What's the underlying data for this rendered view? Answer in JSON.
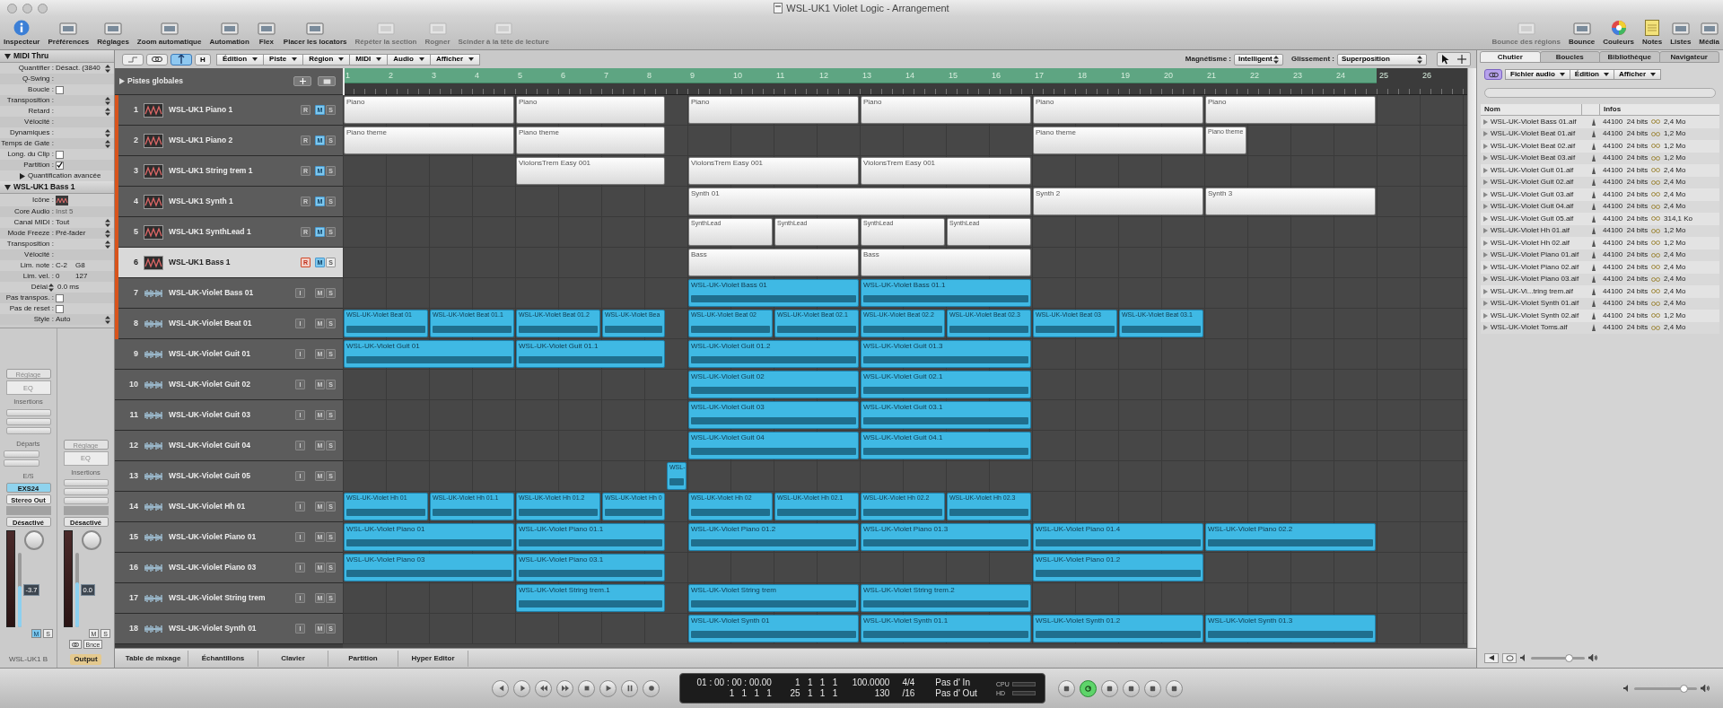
{
  "window": {
    "title": "WSL-UK1 Violet Logic - Arrangement"
  },
  "toolbar": {
    "left": [
      {
        "label": "Inspecteur",
        "active": true,
        "disabled": false
      },
      {
        "label": "Préférences",
        "active": false,
        "disabled": false
      },
      {
        "label": "Réglages",
        "active": false,
        "disabled": false
      },
      {
        "label": "Zoom automatique",
        "active": false,
        "disabled": false
      },
      {
        "label": "Automation",
        "active": false,
        "disabled": false
      },
      {
        "label": "Flex",
        "active": false,
        "disabled": false
      },
      {
        "label": "Placer les locators",
        "active": false,
        "disabled": false
      },
      {
        "label": "Répéter la section",
        "active": false,
        "disabled": true
      },
      {
        "label": "Rogner",
        "active": false,
        "disabled": true
      },
      {
        "label": "Scinder à la tête de lecture",
        "active": false,
        "disabled": true
      }
    ],
    "right": [
      {
        "label": "Bounce des régions",
        "active": false,
        "disabled": true
      },
      {
        "label": "Bounce",
        "active": false,
        "disabled": false
      },
      {
        "label": "Couleurs",
        "active": false,
        "disabled": false
      },
      {
        "label": "Notes",
        "active": false,
        "disabled": false
      },
      {
        "label": "Listes",
        "active": false,
        "disabled": false
      },
      {
        "label": "Média",
        "active": false,
        "disabled": false
      }
    ]
  },
  "inspector": {
    "sections": [
      {
        "title": "MIDI Thru",
        "rows": [
          {
            "label": "Quantifier :",
            "kind": "select",
            "value": "Désact. (3840"
          },
          {
            "label": "Q-Swing :",
            "kind": "label"
          },
          {
            "label": "Boucle :",
            "kind": "checkbox",
            "checked": false
          },
          {
            "label": "Transposition :",
            "kind": "select"
          },
          {
            "label": "Retard :",
            "kind": "select"
          },
          {
            "label": "Vélocité :",
            "kind": "label"
          },
          {
            "label": "Dynamiques :",
            "kind": "select"
          },
          {
            "label": "Temps de Gate :",
            "kind": "select"
          },
          {
            "label": "Long. du Clip :",
            "kind": "checkbox",
            "checked": false
          },
          {
            "label": "Partition :",
            "kind": "checkbox",
            "checked": true
          },
          {
            "label": "Quantification avancée",
            "kind": "disclosure"
          }
        ]
      },
      {
        "title": "WSL-UK1 Bass 1",
        "rows": [
          {
            "label": "Icône :",
            "kind": "icon"
          },
          {
            "label": "Core Audio :",
            "kind": "dim",
            "value": "Inst 5"
          },
          {
            "label": "Canal MIDI :",
            "kind": "select",
            "value": "Tout"
          },
          {
            "label": "Mode Freeze :",
            "kind": "select",
            "value": "Pré-fader"
          },
          {
            "label": "Transposition :",
            "kind": "select"
          },
          {
            "label": "Vélocité :",
            "kind": "label"
          },
          {
            "label": "Lim. note :",
            "kind": "pair",
            "values": [
              "C-2",
              "G8"
            ]
          },
          {
            "label": "Lim. vel. :",
            "kind": "pair",
            "values": [
              "0",
              "127"
            ]
          },
          {
            "label": "Délai",
            "kind": "stepper",
            "value": "0.0 ms"
          },
          {
            "label": "Pas transpos. :",
            "kind": "checkbox",
            "checked": false
          },
          {
            "label": "Pas de reset :",
            "kind": "checkbox",
            "checked": false
          },
          {
            "label": "Style :",
            "kind": "select",
            "value": "Auto"
          }
        ]
      }
    ],
    "strips": [
      {
        "setting": "Réglage",
        "eq": "EQ",
        "inserts": "Insertions",
        "sends": "Départs",
        "io": "E/S",
        "input": "EXS24",
        "output": "Stereo Out",
        "automation": "Désactivé",
        "volume": "-3.7",
        "level": 0.55,
        "mute": "M",
        "muted": true,
        "solo": "S",
        "name": "WSL-UK1 B",
        "highlight": false
      },
      {
        "setting": "Réglage",
        "eq": "EQ",
        "inserts": "Insertions",
        "automation": "Désactivé",
        "volume": "0.0",
        "level": 0.6,
        "mute": "M",
        "muted": false,
        "solo": "S",
        "bounce": "Bnce",
        "name": "Output",
        "highlight": true
      }
    ]
  },
  "arrange": {
    "toggles": [
      {
        "on": false
      },
      {
        "on": false
      },
      {
        "on": true
      }
    ],
    "h_button": "H",
    "menus": [
      "Édition",
      "Piste",
      "Région",
      "MIDI",
      "Audio",
      "Afficher"
    ],
    "snap": {
      "label": "Magnétisme :",
      "value": "Intelligent"
    },
    "drag": {
      "label": "Glissement :",
      "value": "Superposition"
    },
    "global_tracks": "Pistes globales",
    "ruler": {
      "bars": [
        "1",
        "2",
        "3",
        "4",
        "5",
        "6",
        "7",
        "8",
        "9",
        "10",
        "11",
        "12",
        "13",
        "14",
        "15",
        "16",
        "17",
        "18",
        "19",
        "20",
        "21",
        "22",
        "23",
        "24",
        "25",
        "26"
      ]
    },
    "tracks": [
      {
        "number": "1",
        "kind": "software",
        "name": "WSL-UK1 Piano 1",
        "selected": false,
        "marker": true,
        "buttons": [
          {
            "label": "R",
            "on": false
          },
          {
            "label": "M",
            "on": true
          },
          {
            "label": "S",
            "on": false
          }
        ],
        "regions": [
          {
            "name": "Piano"
          },
          {
            "name": "Piano"
          },
          {
            "name": "Piano"
          },
          {
            "name": "Piano"
          },
          {
            "name": "Piano"
          },
          {
            "name": "Piano"
          }
        ]
      },
      {
        "number": "2",
        "kind": "software",
        "name": "WSL-UK1 Piano 2",
        "selected": false,
        "marker": true,
        "buttons": [
          {
            "label": "R",
            "on": false
          },
          {
            "label": "M",
            "on": true
          },
          {
            "label": "S",
            "on": false
          }
        ],
        "regions": [
          {
            "name": "Piano theme"
          },
          {
            "name": "Piano theme"
          },
          {
            "name": "Piano theme"
          },
          {
            "name": "Piano theme"
          }
        ]
      },
      {
        "number": "3",
        "kind": "software",
        "name": "WSL-UK1 String trem 1",
        "selected": false,
        "marker": true,
        "buttons": [
          {
            "label": "R",
            "on": false
          },
          {
            "label": "M",
            "on": true
          },
          {
            "label": "S",
            "on": false
          }
        ],
        "regions": [
          {
            "name": "ViolonsTrem Easy 001"
          },
          {
            "name": "ViolonsTrem Easy 001"
          },
          {
            "name": "ViolonsTrem Easy 001"
          }
        ]
      },
      {
        "number": "4",
        "kind": "software",
        "name": "WSL-UK1 Synth 1",
        "selected": false,
        "marker": true,
        "buttons": [
          {
            "label": "R",
            "on": false
          },
          {
            "label": "M",
            "on": true
          },
          {
            "label": "S",
            "on": false
          }
        ],
        "regions": [
          {
            "name": "Synth 01"
          },
          {
            "name": "Synth 2"
          },
          {
            "name": "Synth 3"
          }
        ]
      },
      {
        "number": "5",
        "kind": "software",
        "name": "WSL-UK1 SynthLead 1",
        "selected": false,
        "marker": true,
        "buttons": [
          {
            "label": "R",
            "on": false
          },
          {
            "label": "M",
            "on": true
          },
          {
            "label": "S",
            "on": false
          }
        ],
        "regions": [
          {
            "name": "SynthLead"
          },
          {
            "name": "SynthLead"
          },
          {
            "name": "SynthLead"
          },
          {
            "name": "SynthLead"
          }
        ]
      },
      {
        "number": "6",
        "kind": "software",
        "name": "WSL-UK1 Bass 1",
        "selected": true,
        "marker": true,
        "buttons": [
          {
            "label": "R",
            "on": true
          },
          {
            "label": "M",
            "on": true
          },
          {
            "label": "S",
            "on": false
          }
        ],
        "regions": [
          {
            "name": "Bass"
          },
          {
            "name": "Bass"
          }
        ]
      },
      {
        "number": "7",
        "kind": "audio",
        "name": "WSL-UK-Violet Bass 01",
        "selected": false,
        "marker": true,
        "buttons": [
          {
            "label": "I",
            "on": false
          },
          {
            "label": "M",
            "on": false
          },
          {
            "label": "S",
            "on": false
          }
        ],
        "regions": [
          {
            "name": "WSL-UK-Violet Bass 01"
          },
          {
            "name": "WSL-UK-Violet Bass 01.1"
          }
        ]
      },
      {
        "number": "8",
        "kind": "audio",
        "name": "WSL-UK-Violet Beat 01",
        "selected": false,
        "marker": true,
        "buttons": [
          {
            "label": "I",
            "on": false
          },
          {
            "label": "M",
            "on": false
          },
          {
            "label": "S",
            "on": false
          }
        ],
        "regions": [
          {
            "name": "WSL-UK-Violet Beat 01"
          },
          {
            "name": "WSL-UK-Violet Beat 01.1"
          },
          {
            "name": "WSL-UK-Violet Beat 01.2"
          },
          {
            "name": "WSL-UK-Violet Bea"
          },
          {
            "name": "WSL-UK-Violet Beat 02"
          },
          {
            "name": "WSL-UK-Violet Beat 02.1"
          },
          {
            "name": "WSL-UK-Violet Beat 02.2"
          },
          {
            "name": "WSL-UK-Violet Beat 02.3"
          },
          {
            "name": "WSL-UK-Violet Beat 03"
          },
          {
            "name": "WSL-UK-Violet Beat 03.1"
          }
        ]
      },
      {
        "number": "9",
        "kind": "audio",
        "name": "WSL-UK-Violet Guit 01",
        "selected": false,
        "marker": false,
        "buttons": [
          {
            "label": "I",
            "on": false
          },
          {
            "label": "M",
            "on": false
          },
          {
            "label": "S",
            "on": false
          }
        ],
        "regions": [
          {
            "name": "WSL-UK-Violet Guit 01"
          },
          {
            "name": "WSL-UK-Violet Guit 01.1"
          },
          {
            "name": "WSL-UK-Violet Guit 01.2"
          },
          {
            "name": "WSL-UK-Violet Guit 01.3"
          }
        ]
      },
      {
        "number": "10",
        "kind": "audio",
        "name": "WSL-UK-Violet Guit 02",
        "selected": false,
        "marker": false,
        "buttons": [
          {
            "label": "I",
            "on": false
          },
          {
            "label": "M",
            "on": false
          },
          {
            "label": "S",
            "on": false
          }
        ],
        "regions": [
          {
            "name": "WSL-UK-Violet Guit 02"
          },
          {
            "name": "WSL-UK-Violet Guit 02.1"
          }
        ]
      },
      {
        "number": "11",
        "kind": "audio",
        "name": "WSL-UK-Violet Guit 03",
        "selected": false,
        "marker": false,
        "buttons": [
          {
            "label": "I",
            "on": false
          },
          {
            "label": "M",
            "on": false
          },
          {
            "label": "S",
            "on": false
          }
        ],
        "regions": [
          {
            "name": "WSL-UK-Violet Guit 03"
          },
          {
            "name": "WSL-UK-Violet Guit 03.1"
          }
        ]
      },
      {
        "number": "12",
        "kind": "audio",
        "name": "WSL-UK-Violet Guit 04",
        "selected": false,
        "marker": false,
        "buttons": [
          {
            "label": "I",
            "on": false
          },
          {
            "label": "M",
            "on": false
          },
          {
            "label": "S",
            "on": false
          }
        ],
        "regions": [
          {
            "name": "WSL-UK-Violet Guit 04"
          },
          {
            "name": "WSL-UK-Violet Guit 04.1"
          }
        ]
      },
      {
        "number": "13",
        "kind": "audio",
        "name": "WSL-UK-Violet Guit 05",
        "selected": false,
        "marker": false,
        "buttons": [
          {
            "label": "I",
            "on": false
          },
          {
            "label": "M",
            "on": false
          },
          {
            "label": "S",
            "on": false
          }
        ],
        "regions": [
          {
            "name": "WSL-"
          }
        ]
      },
      {
        "number": "14",
        "kind": "audio",
        "name": "WSL-UK-Violet Hh 01",
        "selected": false,
        "marker": false,
        "buttons": [
          {
            "label": "I",
            "on": false
          },
          {
            "label": "M",
            "on": false
          },
          {
            "label": "S",
            "on": false
          }
        ],
        "regions": [
          {
            "name": "WSL-UK-Violet Hh 01"
          },
          {
            "name": "WSL-UK-Violet Hh 01.1"
          },
          {
            "name": "WSL-UK-Violet Hh 01.2"
          },
          {
            "name": "WSL-UK-Violet Hh 0"
          },
          {
            "name": "WSL-UK-Violet Hh 02"
          },
          {
            "name": "WSL-UK-Violet Hh 02.1"
          },
          {
            "name": "WSL-UK-Violet Hh 02.2"
          },
          {
            "name": "WSL-UK-Violet Hh 02.3"
          }
        ]
      },
      {
        "number": "15",
        "kind": "audio",
        "name": "WSL-UK-Violet Piano 01",
        "selected": false,
        "marker": false,
        "buttons": [
          {
            "label": "I",
            "on": false
          },
          {
            "label": "M",
            "on": false
          },
          {
            "label": "S",
            "on": false
          }
        ],
        "regions": [
          {
            "name": "WSL-UK-Violet Piano 01"
          },
          {
            "name": "WSL-UK-Violet Piano 01.1"
          },
          {
            "name": "WSL-UK-Violet Piano 01.2"
          },
          {
            "name": "WSL-UK-Violet Piano 01.3"
          },
          {
            "name": "WSL-UK-Violet Piano 01.4"
          },
          {
            "name": "WSL-UK-Violet Piano 02.2"
          }
        ]
      },
      {
        "number": "16",
        "kind": "audio",
        "name": "WSL-UK-Violet Piano 03",
        "selected": false,
        "marker": false,
        "buttons": [
          {
            "label": "I",
            "on": false
          },
          {
            "label": "M",
            "on": false
          },
          {
            "label": "S",
            "on": false
          }
        ],
        "regions": [
          {
            "name": "WSL-UK-Violet Piano 03"
          },
          {
            "name": "WSL-UK-Violet Piano 03.1"
          },
          {
            "name": "WSL-UK-Violet Piano 01.2"
          }
        ]
      },
      {
        "number": "17",
        "kind": "audio",
        "name": "WSL-UK-Violet String trem",
        "selected": false,
        "marker": false,
        "buttons": [
          {
            "label": "I",
            "on": false
          },
          {
            "label": "M",
            "on": false
          },
          {
            "label": "S",
            "on": false
          }
        ],
        "regions": [
          {
            "name": "WSL-UK-Violet String trem.1"
          },
          {
            "name": "WSL-UK-Violet String trem"
          },
          {
            "name": "WSL-UK-Violet String trem.2"
          }
        ]
      },
      {
        "number": "18",
        "kind": "audio",
        "name": "WSL-UK-Violet Synth 01",
        "selected": false,
        "marker": false,
        "buttons": [
          {
            "label": "I",
            "on": false
          },
          {
            "label": "M",
            "on": false
          },
          {
            "label": "S",
            "on": false
          }
        ],
        "regions": [
          {
            "name": "WSL-UK-Violet Synth 01"
          },
          {
            "name": "WSL-UK-Violet Synth 01.1"
          },
          {
            "name": "WSL-UK-Violet Synth 01.2"
          },
          {
            "name": "WSL-UK-Violet Synth 01.3"
          }
        ]
      }
    ],
    "bottom_tabs": [
      "Table de mixage",
      "Échantillons",
      "Clavier",
      "Partition",
      "Hyper Editor"
    ]
  },
  "browser": {
    "tabs": [
      {
        "label": "Chutier",
        "selected": true
      },
      {
        "label": "Boucles",
        "selected": false
      },
      {
        "label": "Bibliothèque",
        "selected": false
      },
      {
        "label": "Navigateur",
        "selected": false
      }
    ],
    "menus": [
      "Fichier audio",
      "Édition",
      "Afficher"
    ],
    "columns": [
      "Nom",
      "Infos"
    ],
    "files": [
      {
        "name": "WSL-UK-Violet Bass 01.aif",
        "format": "44100  24 bits",
        "size": "2,4 Mo"
      },
      {
        "name": "WSL-UK-Violet Beat 01.aif",
        "format": "44100  24 bits",
        "size": "1,2 Mo"
      },
      {
        "name": "WSL-UK-Violet Beat 02.aif",
        "format": "44100  24 bits",
        "size": "1,2 Mo"
      },
      {
        "name": "WSL-UK-Violet Beat 03.aif",
        "format": "44100  24 bits",
        "size": "1,2 Mo"
      },
      {
        "name": "WSL-UK-Violet Guit 01.aif",
        "format": "44100  24 bits",
        "size": "2,4 Mo"
      },
      {
        "name": "WSL-UK-Violet Guit 02.aif",
        "format": "44100  24 bits",
        "size": "2,4 Mo"
      },
      {
        "name": "WSL-UK-Violet Guit 03.aif",
        "format": "44100  24 bits",
        "size": "2,4 Mo"
      },
      {
        "name": "WSL-UK-Violet Guit 04.aif",
        "format": "44100  24 bits",
        "size": "2,4 Mo"
      },
      {
        "name": "WSL-UK-Violet Guit 05.aif",
        "format": "44100  24 bits",
        "size": "314,1 Ko"
      },
      {
        "name": "WSL-UK-Violet Hh 01.aif",
        "format": "44100  24 bits",
        "size": "1,2 Mo"
      },
      {
        "name": "WSL-UK-Violet Hh 02.aif",
        "format": "44100  24 bits",
        "size": "1,2 Mo"
      },
      {
        "name": "WSL-UK-Violet Piano 01.aif",
        "format": "44100  24 bits",
        "size": "2,4 Mo"
      },
      {
        "name": "WSL-UK-Violet Piano 02.aif",
        "format": "44100  24 bits",
        "size": "2,4 Mo"
      },
      {
        "name": "WSL-UK-Violet Piano 03.aif",
        "format": "44100  24 bits",
        "size": "2,4 Mo"
      },
      {
        "name": "WSL-UK-Vi...tring trem.aif",
        "format": "44100  24 bits",
        "size": "2,4 Mo"
      },
      {
        "name": "WSL-UK-Violet Synth 01.aif",
        "format": "44100  24 bits",
        "size": "2,4 Mo"
      },
      {
        "name": "WSL-UK-Violet Synth 02.aif",
        "format": "44100  24 bits",
        "size": "1,2 Mo"
      },
      {
        "name": "WSL-UK-Violet Toms.aif",
        "format": "44100  24 bits",
        "size": "2,4 Mo"
      }
    ],
    "volume": {
      "level": 0.7
    }
  },
  "transport": {
    "smpte": "01 : 00 : 00 : 00.00",
    "bar_position": "1   1   1   1",
    "left_locator": "1   1   1   1",
    "right_locator": "25   1   1   1",
    "tempo_precise": "100.0000",
    "tempo": "130",
    "signature": "4/4",
    "division": "/16",
    "midi_in": "Pas d' In",
    "midi_out": "Pas d' Out",
    "meter_labels": [
      "CPU",
      "HD"
    ],
    "cycle_on": true,
    "volume": {
      "level": 0.78
    }
  }
}
